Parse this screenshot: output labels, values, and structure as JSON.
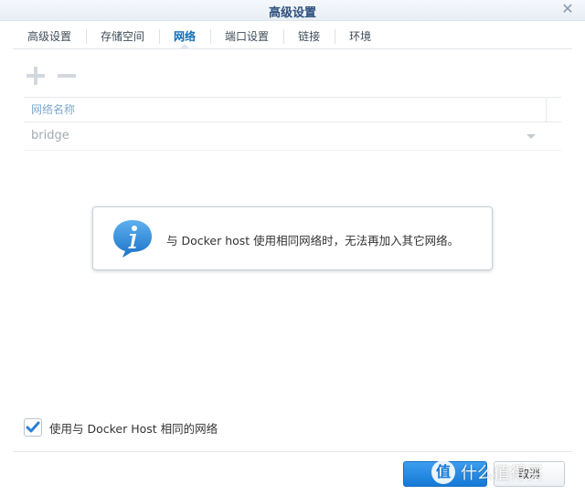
{
  "window": {
    "title": "高级设置"
  },
  "tabs": [
    {
      "label": "高级设置"
    },
    {
      "label": "存储空间"
    },
    {
      "label": "网络"
    },
    {
      "label": "端口设置"
    },
    {
      "label": "链接"
    },
    {
      "label": "环境"
    }
  ],
  "active_tab_index": 2,
  "toolbar": {
    "add_icon": "plus-icon",
    "remove_icon": "minus-icon"
  },
  "grid": {
    "column_header": "网络名称",
    "rows": [
      {
        "name": "bridge"
      }
    ]
  },
  "tooltip": {
    "icon": "info-icon",
    "text": "与 Docker host 使用相同网络时，无法再加入其它网络。"
  },
  "checkbox": {
    "label": "使用与 Docker Host 相同的网络",
    "checked": true
  },
  "footer": {
    "apply_label": "",
    "cancel_label": "取消"
  },
  "watermark": {
    "logo_char": "值",
    "text": "什么值得买"
  },
  "colors": {
    "accent": "#1579d6",
    "active_tab": "#0e6eb8",
    "title": "#2d4f7c",
    "checkbox_check": "#2a7fd4"
  }
}
